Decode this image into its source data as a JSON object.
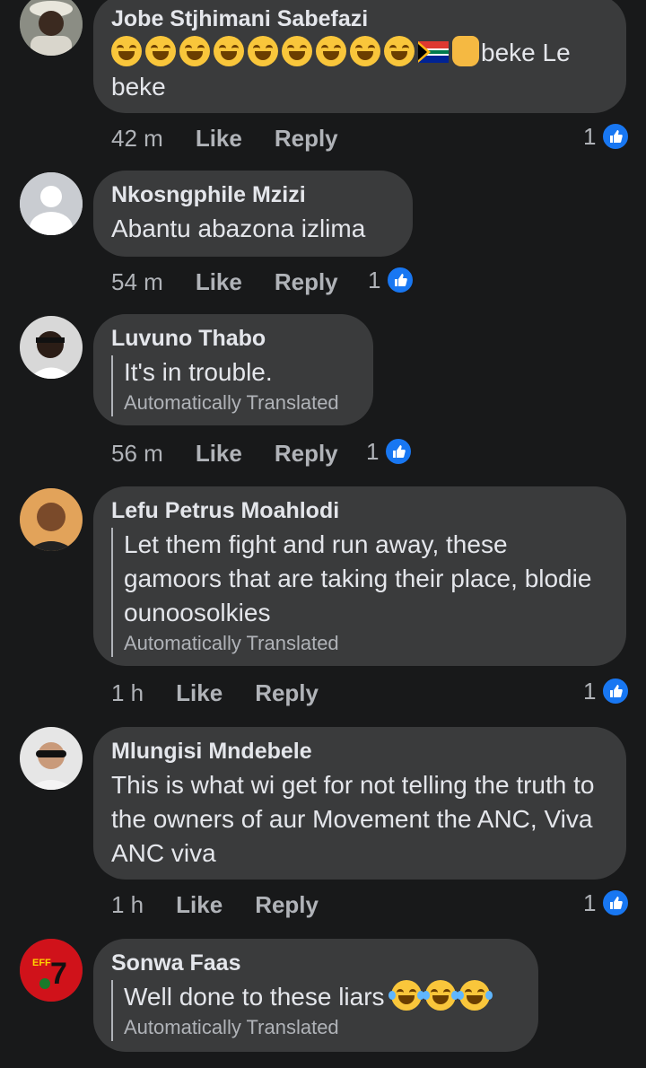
{
  "comments": [
    {
      "name": "Jobe Stjhimani Sabefazi",
      "text_emojis": [
        "rofl-emoji",
        "rofl-emoji",
        "rofl-emoji",
        "rofl-emoji",
        "rofl-emoji",
        "rofl-emoji",
        "rofl-emoji",
        "rofl-emoji",
        "rofl-emoji",
        "south-africa-flag",
        "raised-fist-emoji"
      ],
      "text": "beke Le beke",
      "time": "42 m",
      "like_label": "Like",
      "reply_label": "Reply",
      "reaction_count": "1"
    },
    {
      "name": "Nkosngphile Mzizi",
      "text": "Abantu abazona izlima",
      "time": "54 m",
      "like_label": "Like",
      "reply_label": "Reply",
      "reaction_count": "1"
    },
    {
      "name": "Luvuno Thabo",
      "text": "It's in trouble.",
      "translated": "Automatically Translated",
      "time": "56 m",
      "like_label": "Like",
      "reply_label": "Reply",
      "reaction_count": "1"
    },
    {
      "name": "Lefu Petrus Moahlodi",
      "text": "Let them fight and run away, these gamoors that are taking their place, blodie ounoosolkies",
      "translated": "Automatically Translated",
      "time": "1 h",
      "like_label": "Like",
      "reply_label": "Reply",
      "reaction_count": "1"
    },
    {
      "name": "Mlungisi Mndebele",
      "text": "This is what wi get for not telling the truth to the owners of aur Movement the ANC, Viva ANC viva",
      "time": "1 h",
      "like_label": "Like",
      "reply_label": "Reply",
      "reaction_count": "1"
    },
    {
      "name": "Sonwa Faas",
      "text": "Well done to these liars",
      "text_emojis_after": [
        "joy-emoji",
        "joy-emoji",
        "joy-emoji"
      ],
      "translated": "Automatically Translated"
    }
  ],
  "colors": {
    "background": "#18191a",
    "bubble": "#3a3b3c",
    "text": "#e4e6eb",
    "secondary": "#b0b3b8",
    "like_blue": "#1877f2"
  }
}
